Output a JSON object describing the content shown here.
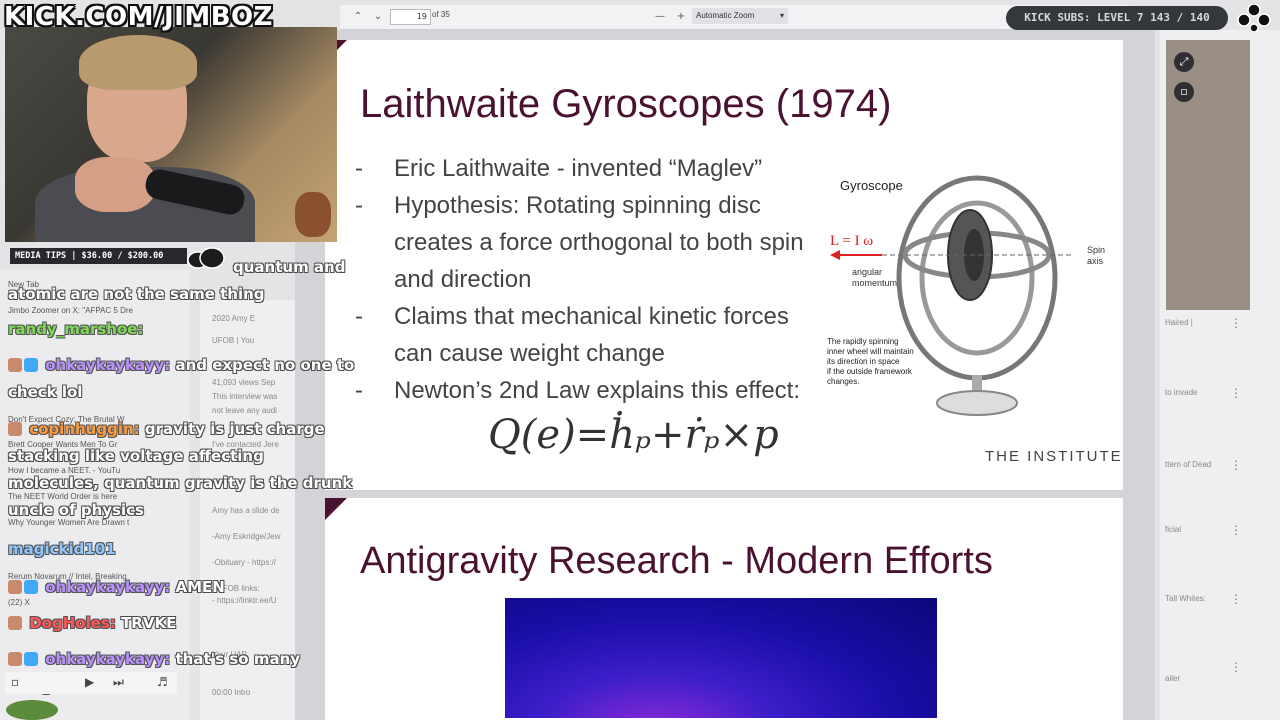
{
  "stream": {
    "banner": "KICK.COM/JIMBOZ",
    "subs": "KICK SUBS: LEVEL 7 143 / 140",
    "tips": "MEDIA TIPS | $36.00 / $200.00"
  },
  "pdf_toolbar": {
    "page_current": "19",
    "page_total": "of 35",
    "zoom": "Automatic Zoom"
  },
  "slide1": {
    "title": "Laithwaite Gyroscopes (1974)",
    "bullets": [
      "Eric Laithwaite - invented “Maglev”",
      "Hypothesis: Rotating spinning disc creates a force orthogonal to both spin and direction",
      "Claims that mechanical kinetic forces can cause weight change",
      "Newton’s 2nd Law explains this effect:"
    ],
    "formula": "Q(e)=ḣₚ+ṙₚ×p",
    "logo": "THE INSTITUTE",
    "diagram": {
      "title": "Gyroscope",
      "equation": "L = I ω",
      "angular_label_1": "angular",
      "angular_label_2": "momentum",
      "spin_label_1": "Spin",
      "spin_label_2": "axis",
      "caption_1": "The rapidly spinning",
      "caption_2": "inner wheel will maintain",
      "caption_3": "its direction in space",
      "caption_4": "if the outside framework",
      "caption_5": "changes."
    }
  },
  "slide2": {
    "title": "Antigravity Research - Modern Efforts"
  },
  "chat": [
    {
      "user": "",
      "text": "quantum and atomic are not the same thing"
    },
    {
      "user": "randy_marshoe:",
      "text": ""
    },
    {
      "user": "ohkaykaykayy:",
      "text": "and expect no one to check lol"
    },
    {
      "user": "copinhuggin:",
      "text": "gravity is just charge stacking like voltage affecting molecules, quantum gravity is the drunk uncle of physics"
    },
    {
      "user": "magickid101",
      "text": ""
    },
    {
      "user": "ohkaykaykayy:",
      "text": "AMEN"
    },
    {
      "user": "DogHoles:",
      "text": "TRVKE"
    },
    {
      "user": "ohkaykaykayy:",
      "text": "that's so many things"
    }
  ],
  "colors": {
    "slide_accent": "#4a1230",
    "user_green": "#7ed957",
    "user_purple": "#b891ff",
    "user_orange": "#ff9a3c",
    "user_blue": "#8fc8ff",
    "user_red": "#ff5757"
  },
  "background_tabs": [
    "New Tab",
    "Jimbo Zoomer on X: \"AFPAC 5 Dre",
    "Don't Expect Cozy: The Brutal W",
    "Brett Cooper Wants Men To Gr",
    "How I became a NEET. - YouTu",
    "The NEET World Order is here",
    "Why Younger Women Are Drawn t",
    "Rerum Novarum // Intel, Breaking",
    "(22) X"
  ],
  "background_mid": [
    "2020 Amy E",
    "UFOB | You",
    "41,093 views Sep",
    "This interview was",
    "not leave any audi",
    "I've contacted Jere",
    "Amy has a slide de",
    "-Amy Eskridge/Jew",
    "-Obituary - https://",
    "- UFOB links:",
    "- https://linktr.ee/U",
    "Your UAP",
    "00:00 Intro"
  ],
  "right_list": [
    "Haired |",
    "to invade",
    "ttern of Dead",
    "ficial",
    "Tall Whites:",
    "ailer"
  ]
}
